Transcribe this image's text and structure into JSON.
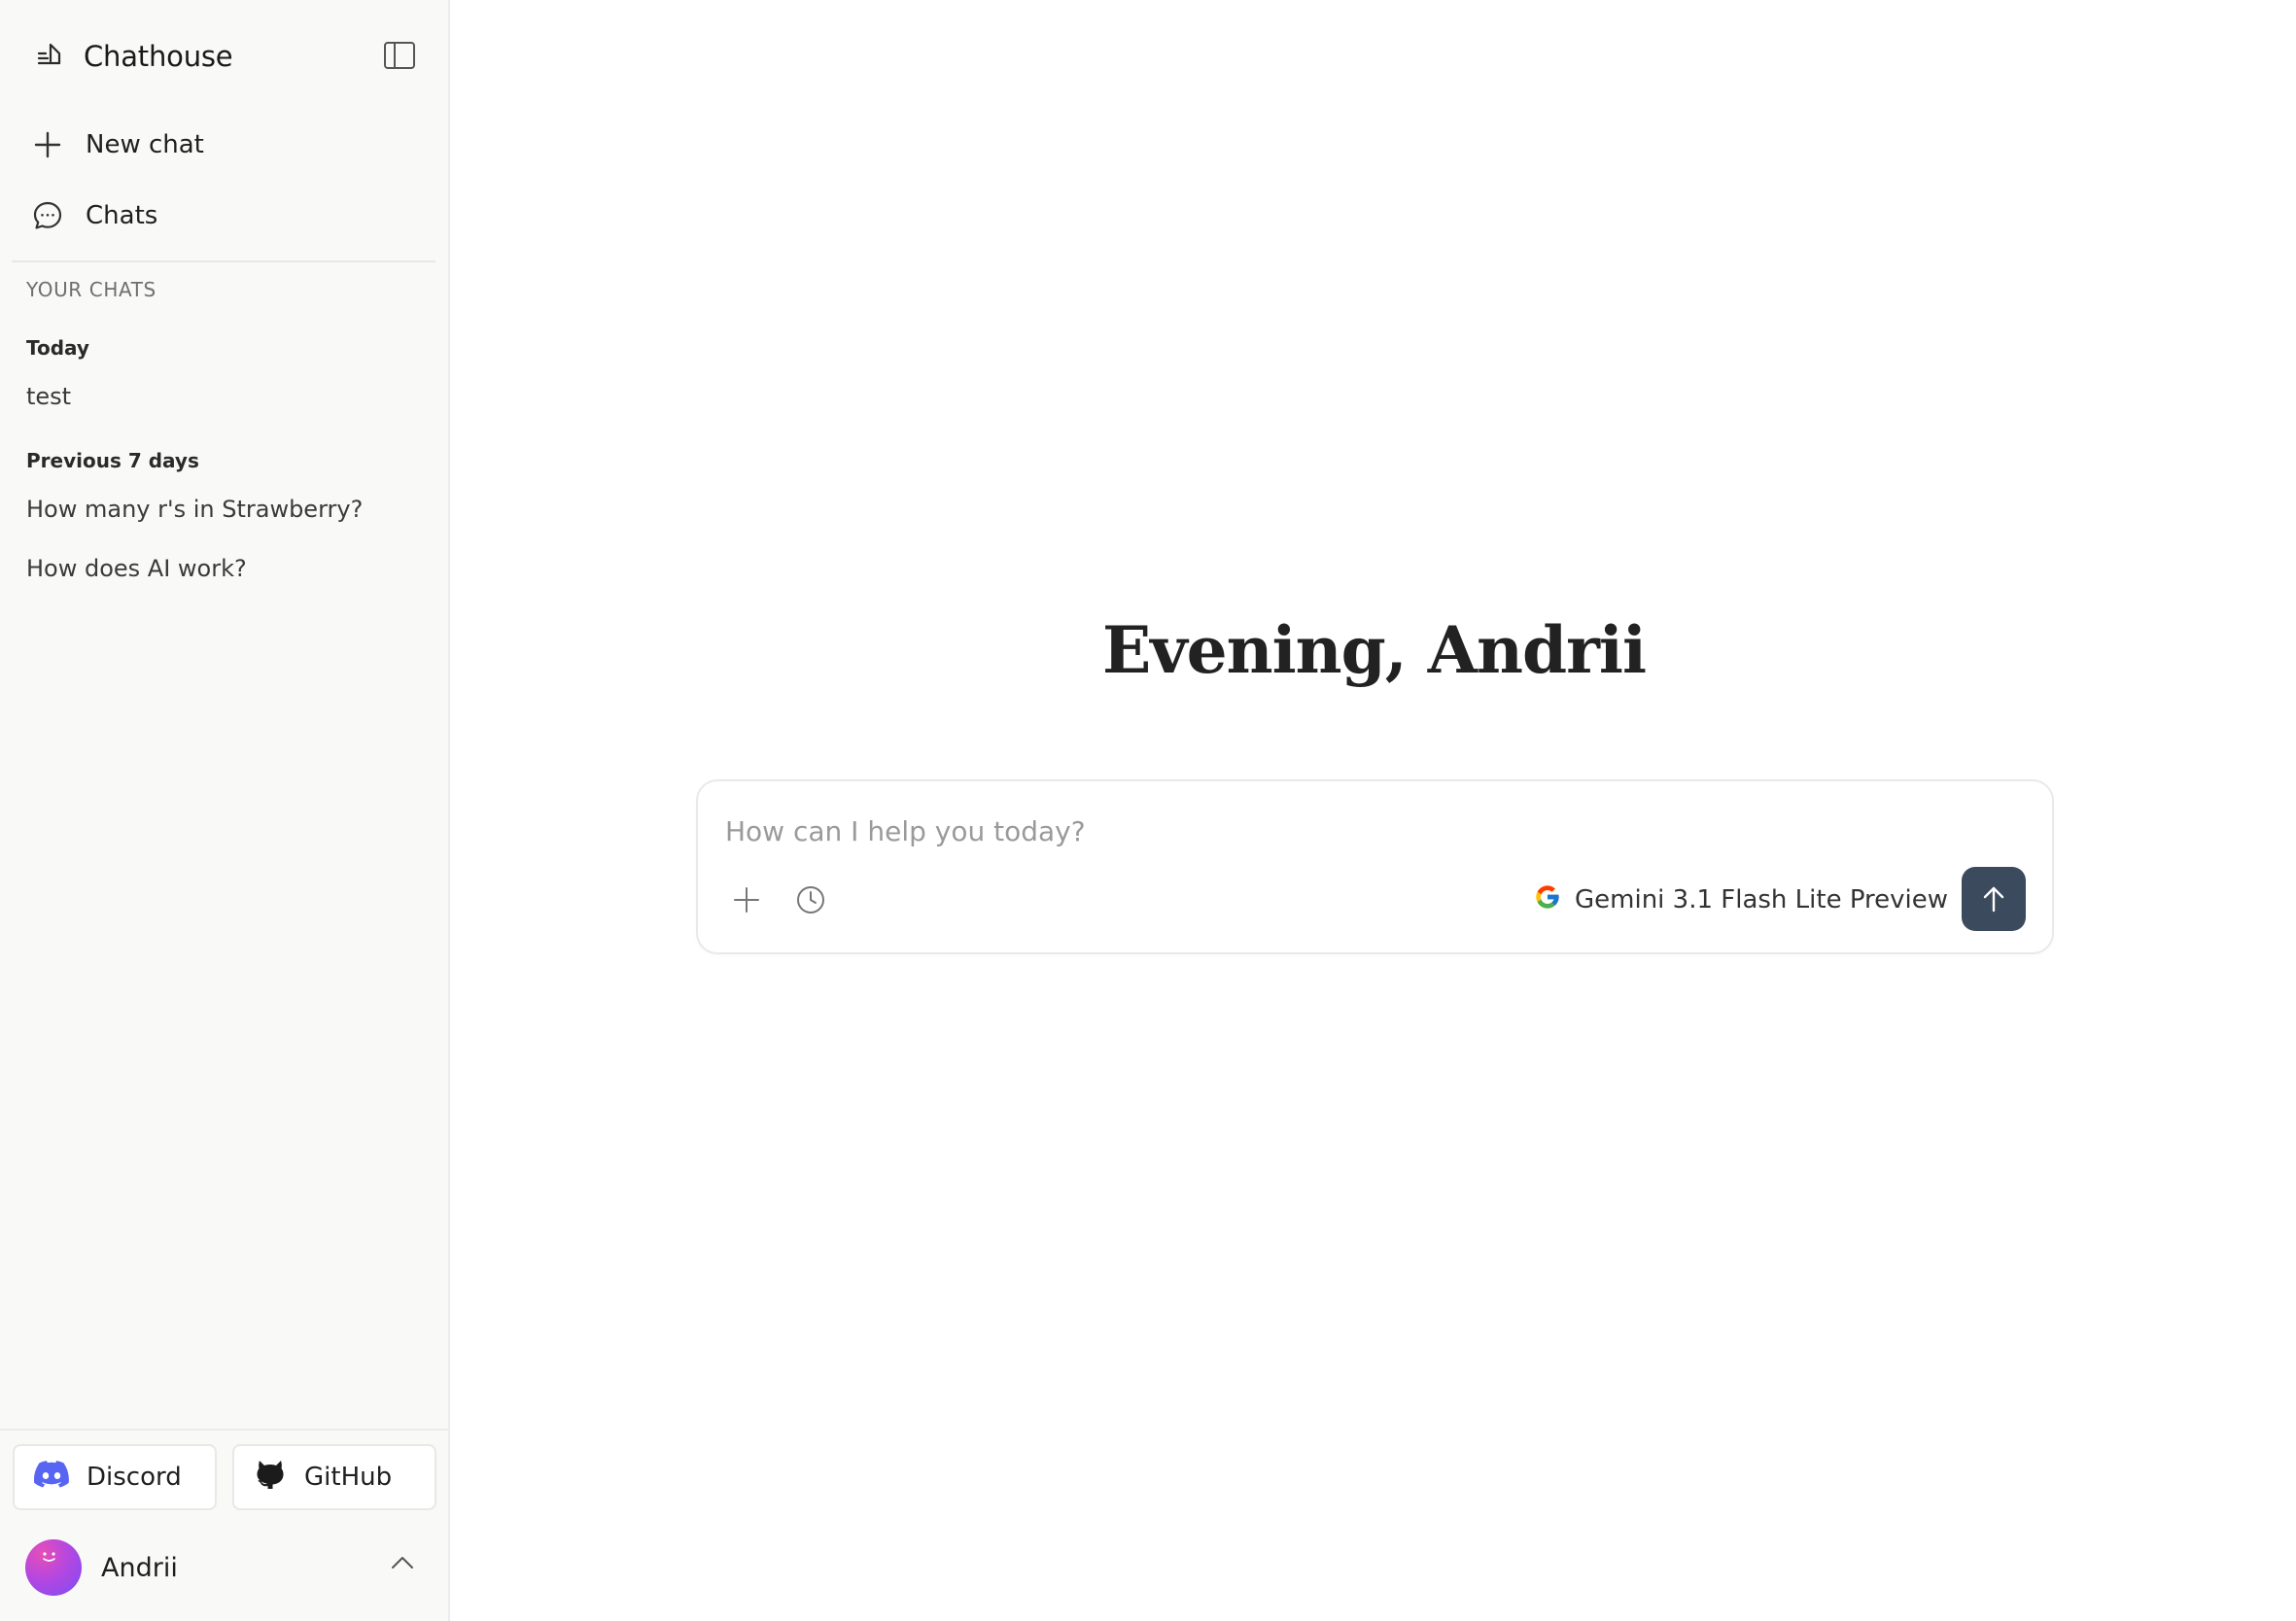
{
  "app": {
    "title": "Chathouse"
  },
  "sidebar": {
    "nav": {
      "new_chat": "New chat",
      "chats": "Chats"
    },
    "section_label": "YOUR CHATS",
    "groups": [
      {
        "label": "Today",
        "items": [
          "test"
        ]
      },
      {
        "label": "Previous 7 days",
        "items": [
          "How many r's in Strawberry?",
          "How does AI work?"
        ]
      }
    ],
    "links": {
      "discord": "Discord",
      "github": "GitHub"
    },
    "user": {
      "name": "Andrii"
    }
  },
  "main": {
    "greeting": "Evening, Andrii",
    "composer": {
      "placeholder": "How can I help you today?",
      "model": "Gemini 3.1 Flash Lite Preview"
    }
  },
  "colors": {
    "send_button": "#3c4a5e",
    "discord": "#5865f2",
    "sidebar_bg": "#f9f9f8"
  },
  "icons": [
    "logo-icon",
    "sidebar-toggle-icon",
    "plus-icon",
    "chat-bubble-icon",
    "discord-icon",
    "github-icon",
    "chevron-up-icon",
    "attach-plus-icon",
    "clock-icon",
    "google-icon",
    "chevron-down-icon",
    "arrow-up-icon"
  ]
}
